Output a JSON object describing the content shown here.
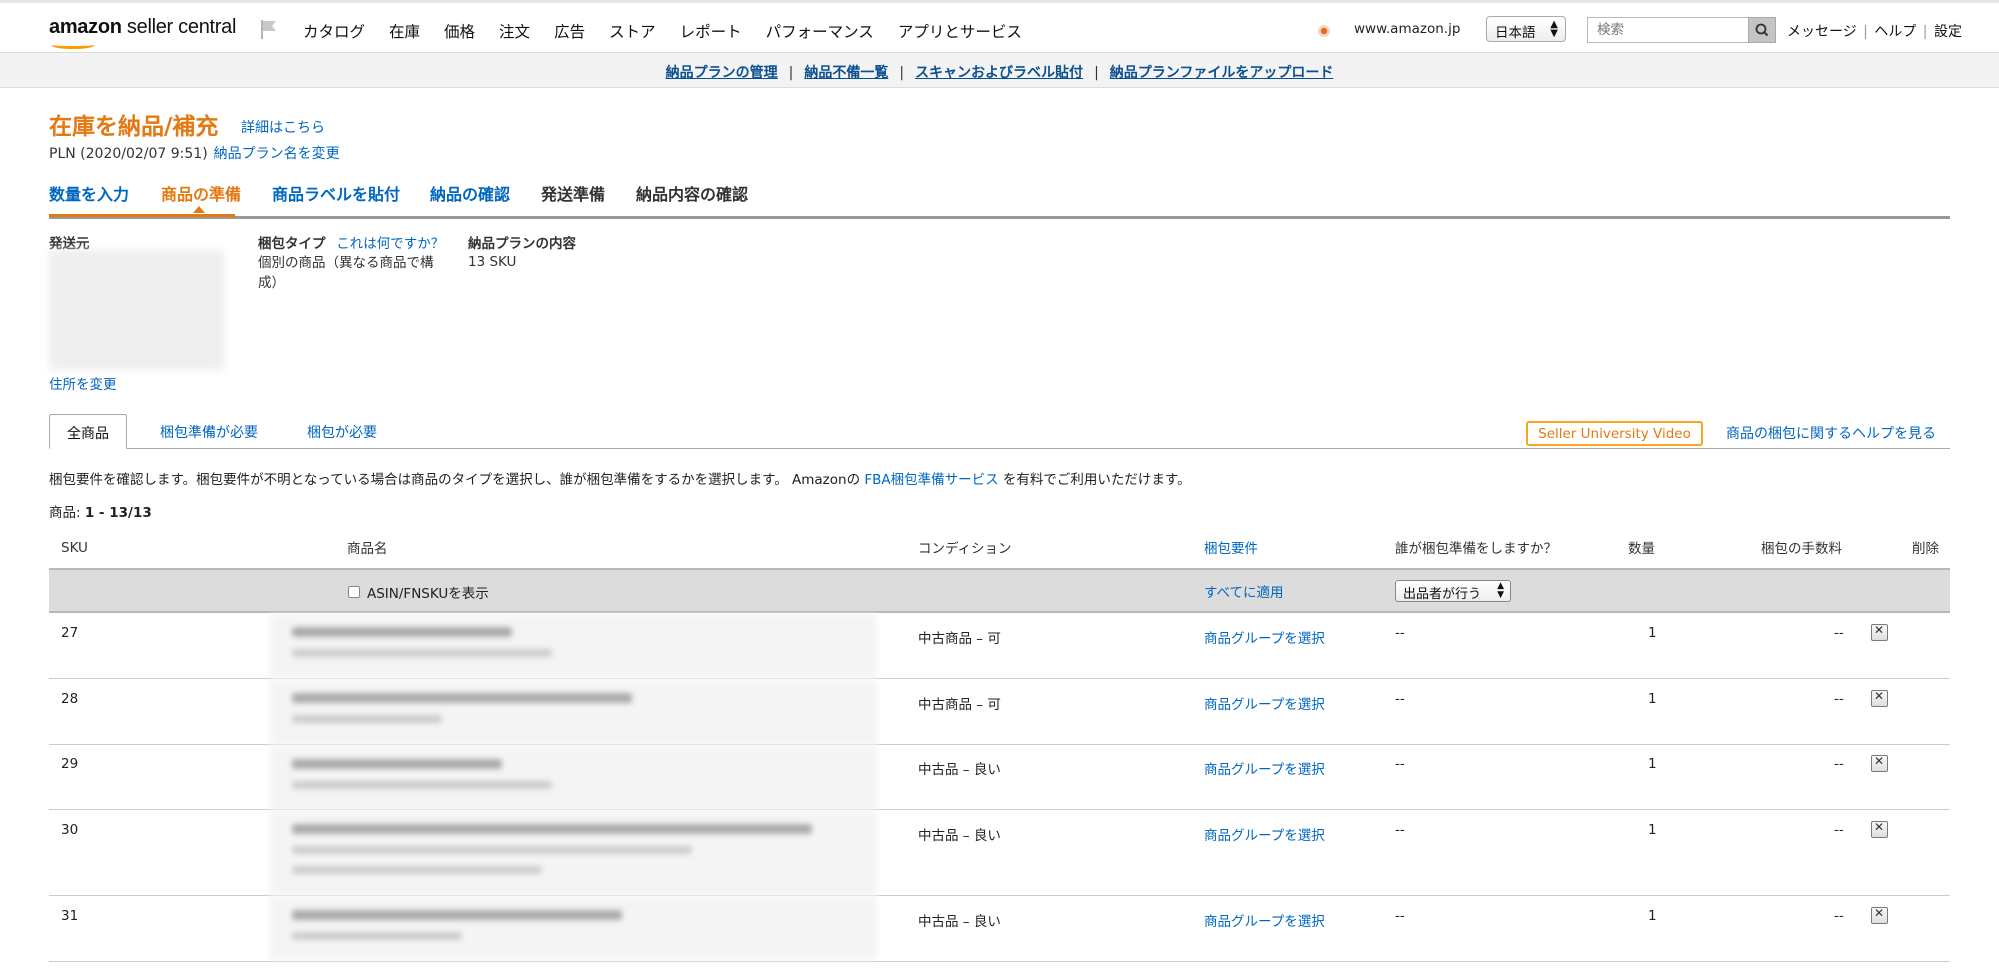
{
  "topnav": {
    "logo_amazon": "amazon",
    "logo_rest": " seller central",
    "menu": [
      "カタログ",
      "在庫",
      "価格",
      "注文",
      "広告",
      "ストア",
      "レポート",
      "パフォーマンス",
      "アプリとサービス"
    ],
    "marketplace": "www.amazon.jp",
    "language": "日本語",
    "search_placeholder": "検索",
    "links": [
      "メッセージ",
      "ヘルプ",
      "設定"
    ]
  },
  "subnav": [
    "納品プランの管理",
    "納品不備一覧",
    "スキャンおよびラベル貼付",
    "納品プランファイルをアップロード"
  ],
  "header": {
    "title": "在庫を納品/補充",
    "details_link": "詳細はこちら",
    "plan_name": "PLN (2020/02/07 9:51)",
    "rename_link": "納品プラン名を変更"
  },
  "steps": [
    {
      "label": "数量を入力",
      "state": "done"
    },
    {
      "label": "商品の準備",
      "state": "current"
    },
    {
      "label": "商品ラベルを貼付",
      "state": "done"
    },
    {
      "label": "納品の確認",
      "state": "done"
    },
    {
      "label": "発送準備",
      "state": "todo"
    },
    {
      "label": "納品内容の確認",
      "state": "todo"
    }
  ],
  "info": {
    "ship_from_label": "発送元",
    "change_address": "住所を変更",
    "packing_type_label": "梱包タイプ",
    "packing_type_help": "これは何ですか？",
    "packing_type_value": "個別の商品（異なる商品で構成）",
    "contents_label": "納品プランの内容",
    "contents_value": "13 SKU"
  },
  "tabs": [
    "全商品",
    "梱包準備が必要",
    "梱包が必要"
  ],
  "video_button": "Seller University Video",
  "help_link": "商品の梱包に関するヘルプを見る",
  "description": {
    "before": "梱包要件を確認します。梱包要件が不明となっている場合は商品のタイプを選択し、誰が梱包準備をするかを選択します。 Amazonの ",
    "link": "FBA梱包準備サービス",
    "after": " を有料でご利用いただけます。"
  },
  "count": {
    "label": "商品: ",
    "value": "1 - 13/13"
  },
  "table": {
    "headers": {
      "sku": "SKU",
      "name": "商品名",
      "condition": "コンディション",
      "prep_req": "梱包要件",
      "who_preps": "誰が梱包準備をしますか？",
      "quantity": "数量",
      "prep_fee": "梱包の手数料",
      "delete": "削除"
    },
    "show_asin": "ASIN/FNSKUを表示",
    "apply_all": "すべてに適用",
    "who_select": "出品者が行う",
    "rows": [
      {
        "sku": "27",
        "condition": "中古商品 – 可",
        "prep": "商品グループを選択",
        "who": "--",
        "qty": "1",
        "fee": "--"
      },
      {
        "sku": "28",
        "condition": "中古商品 – 可",
        "prep": "商品グループを選択",
        "who": "--",
        "qty": "1",
        "fee": "--"
      },
      {
        "sku": "29",
        "condition": "中古品 – 良い",
        "prep": "商品グループを選択",
        "who": "--",
        "qty": "1",
        "fee": "--"
      },
      {
        "sku": "30",
        "condition": "中古品 – 良い",
        "prep": "商品グループを選択",
        "who": "--",
        "qty": "1",
        "fee": "--"
      },
      {
        "sku": "31",
        "condition": "中古品 – 良い",
        "prep": "商品グループを選択",
        "who": "--",
        "qty": "1",
        "fee": "--"
      }
    ]
  },
  "colors": {
    "accent": "#e47911",
    "link": "#0066c0"
  }
}
